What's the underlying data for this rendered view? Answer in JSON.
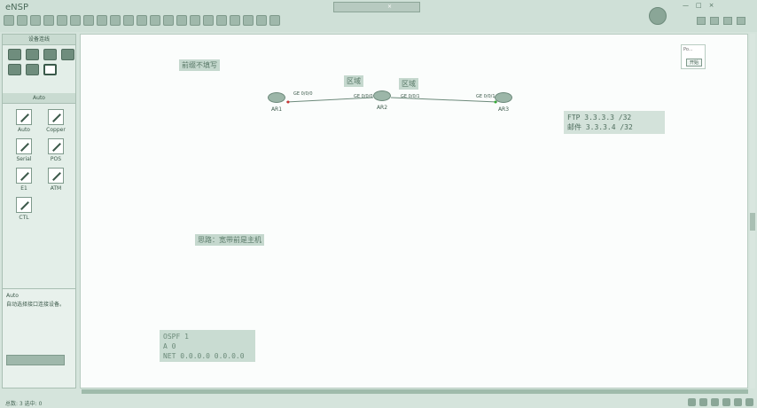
{
  "app": {
    "title": "eNSP",
    "window_caption": "",
    "caption_close": "×"
  },
  "window_controls": [
    "—",
    "□",
    "×"
  ],
  "left_panel": {
    "device_header": "设备连线",
    "cable_header": "Auto",
    "cables": [
      {
        "label": "Auto",
        "icon": "auto-cable-icon"
      },
      {
        "label": "Copper",
        "icon": "copper-cable-icon"
      },
      {
        "label": "Serial",
        "icon": "serial-cable-icon"
      },
      {
        "label": "POS",
        "icon": "pos-cable-icon"
      },
      {
        "label": "E1",
        "icon": "e1-cable-icon"
      },
      {
        "label": "ATM",
        "icon": "atm-cable-icon"
      },
      {
        "label": "CTL",
        "icon": "ctl-cable-icon"
      }
    ],
    "description_title": "Auto",
    "description_text": "自动选择接口连接设备。"
  },
  "canvas": {
    "labels": {
      "top_left": "前缀不填写",
      "link1": "区域",
      "link2": "区域",
      "bottom": "思路：宽带前是主机"
    },
    "routers": [
      {
        "name": "AR1"
      },
      {
        "name": "AR2"
      },
      {
        "name": "AR3"
      }
    ],
    "ports": {
      "ar1_port": "GE 0/0/0",
      "ar2_left_port": "GE 0/0/0",
      "ar2_right_port": "GE 0/0/1",
      "ar3_port": "GE 0/0/1"
    },
    "note": {
      "line1": "FTP  3.3.3.3 /32",
      "line2": "邮件  3.3.3.4 /32"
    },
    "ospf": {
      "line1": "OSPF 1",
      "line2": "A 0",
      "line3": "NET 0.0.0.0 0.0.0.0"
    },
    "start_widget": {
      "top_text": "Po...",
      "button": "开始"
    }
  },
  "status": {
    "text": "总数: 3 选中: 0"
  },
  "colors": {
    "chrome": "#d5e4dc",
    "canvas": "#fbfdfc",
    "accent": "#6f8d7d"
  }
}
